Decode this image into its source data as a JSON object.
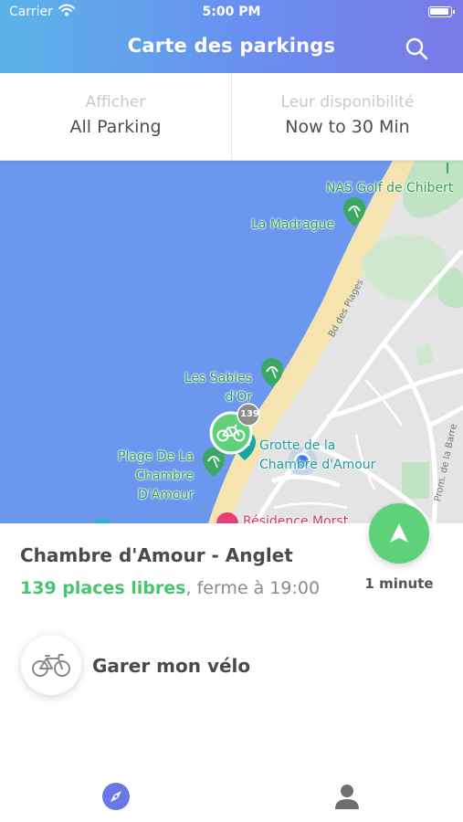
{
  "status_bar": {
    "carrier": "Carrier",
    "time": "5:00 PM"
  },
  "header": {
    "title": "Carte des parkings",
    "search_icon": "search-icon"
  },
  "filters": [
    {
      "label": "Afficher",
      "value": "All Parking"
    },
    {
      "label": "Leur disponibilité",
      "value": "Now to 30 Min"
    }
  ],
  "map": {
    "places": [
      {
        "name": "NAS Golf de Chibert",
        "lines": [
          "NAS Golf de Chibert"
        ],
        "icon": "golf-icon"
      },
      {
        "name": "La Madrague",
        "lines": [
          "La Madrague"
        ],
        "icon": "beach-umbrella-icon"
      },
      {
        "name": "Les Sables d'Or",
        "lines": [
          "Les Sables",
          "d'Or"
        ],
        "icon": "beach-umbrella-icon"
      },
      {
        "name": "Plage De La Chambre D'Amour",
        "lines": [
          "Plage De La",
          "Chambre",
          "D'Amour"
        ],
        "icon": "beach-umbrella-icon"
      },
      {
        "name": "Grotte de la Chambre d'Amour",
        "lines": [
          "Grotte de la",
          "Chambre d'Amour"
        ],
        "icon": "landmark-icon"
      },
      {
        "name": "Résidence Morst",
        "lines": [
          "Résidence Morst"
        ],
        "icon": "residence-icon"
      }
    ],
    "streets": [
      "Bd des Plages",
      "Prom. de la Barre"
    ],
    "selected_marker": {
      "icon": "bicycle-icon",
      "badge": "139"
    },
    "colors": {
      "sea": "#6b97ee",
      "sand": "#f5e3b0",
      "land": "#e4e4e4",
      "park": "#bfe3c3",
      "accent": "#5ed17a"
    }
  },
  "parking": {
    "name": "Chambre d'Amour - Anglet",
    "free_places": "139 places libres",
    "closing": ", ferme à 19:00",
    "eta": "1 minute"
  },
  "actions": {
    "bike_label": "Garer mon vélo"
  },
  "tabs": [
    {
      "name": "map",
      "icon": "compass-icon",
      "active": true
    },
    {
      "name": "profile",
      "icon": "user-icon",
      "active": false
    }
  ]
}
